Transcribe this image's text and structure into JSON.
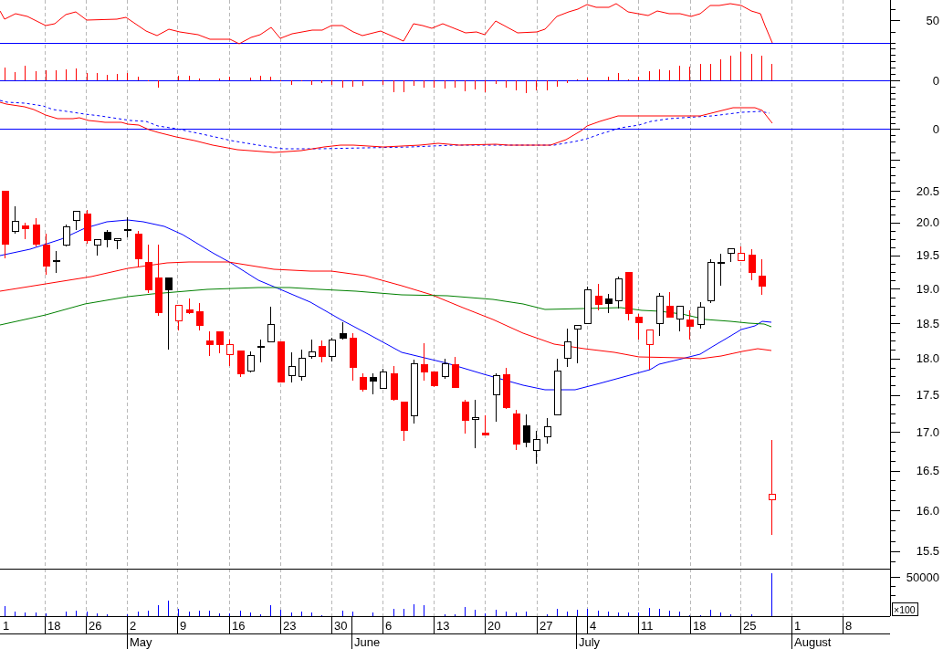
{
  "chart": {
    "panels": [
      {
        "kind": "oscillator",
        "labels": [
          "50"
        ]
      },
      {
        "kind": "histogram",
        "labels": [
          "0"
        ]
      },
      {
        "kind": "crossover",
        "labels": [
          "0"
        ]
      },
      {
        "kind": "candlestick",
        "labels": [
          "20.5",
          "20.0",
          "19.5",
          "19.0",
          "18.5",
          "18.0",
          "17.5",
          "17.0",
          "16.5",
          "16.0",
          "15.5"
        ]
      },
      {
        "kind": "volume",
        "labels": [
          "50000"
        ],
        "scale_label": "×100"
      }
    ],
    "dates": [
      "1",
      "18",
      "26",
      "2",
      "9",
      "16",
      "23",
      "30",
      "6",
      "13",
      "20",
      "27",
      "4",
      "11",
      "18",
      "25",
      "1",
      "8"
    ],
    "months": [
      "May",
      "June",
      "July",
      "August"
    ]
  }
}
